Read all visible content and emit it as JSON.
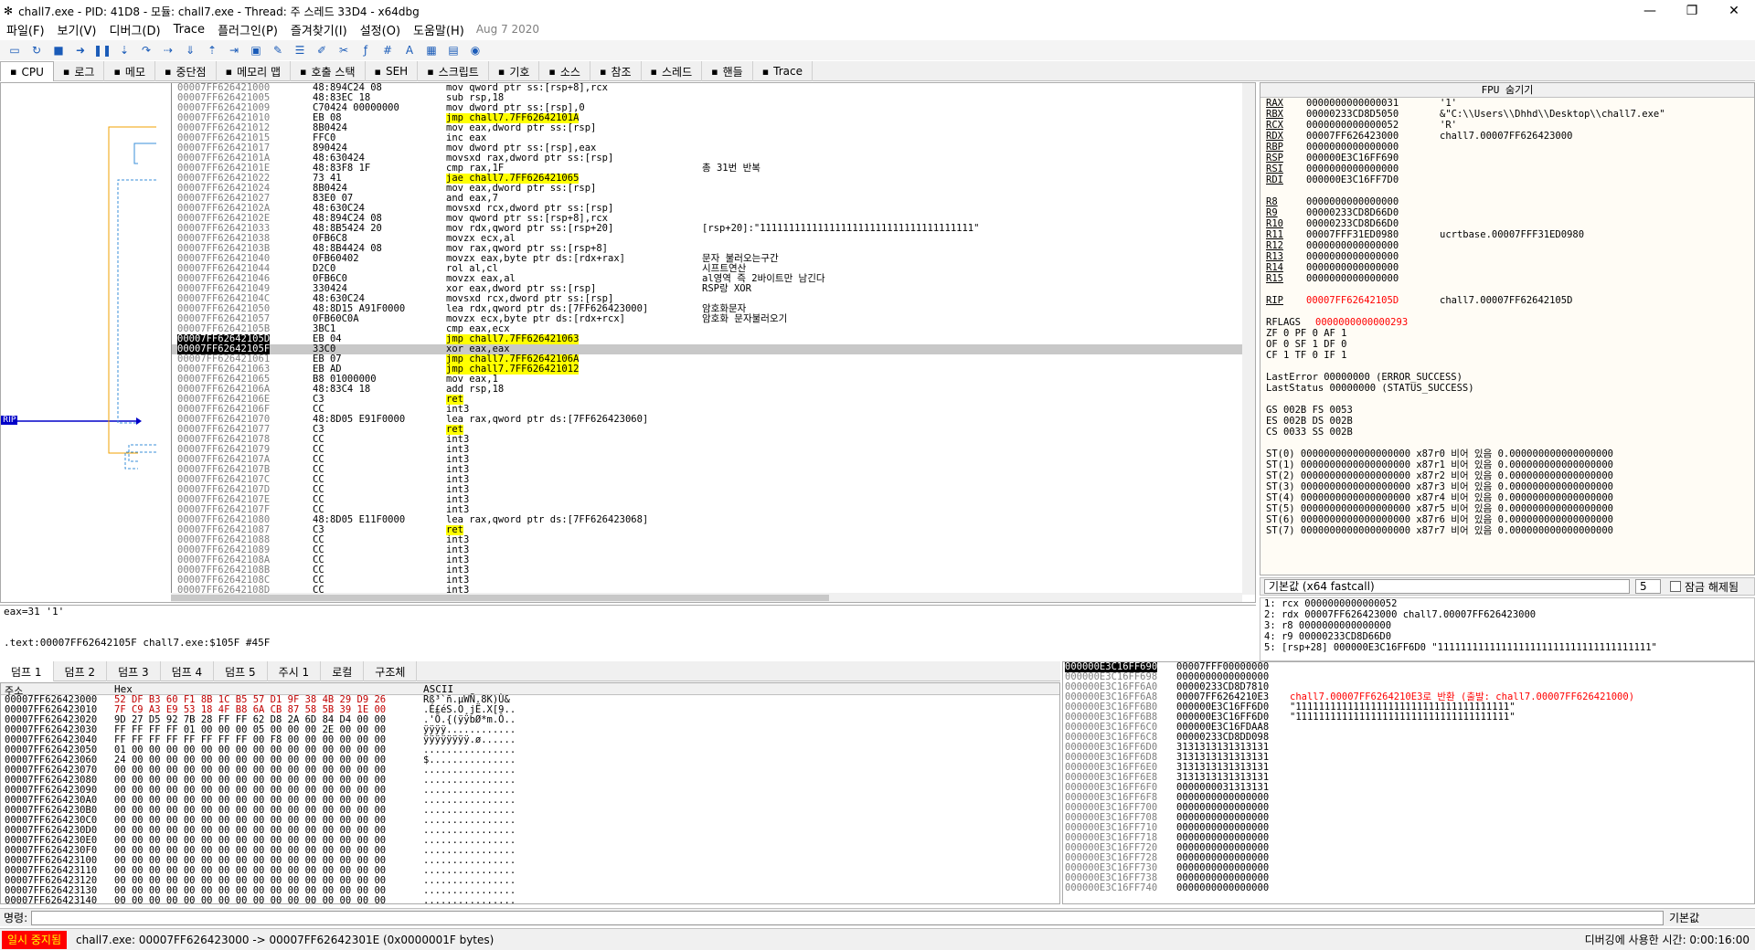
{
  "window": {
    "title": "chall7.exe - PID: 41D8 - 모듈: chall7.exe - Thread: 주 스레드 33D4 - x64dbg",
    "buttons": [
      "—",
      "❐",
      "✕"
    ]
  },
  "menu": {
    "items": [
      "파일(F)",
      "보기(V)",
      "디버그(D)",
      "Trace",
      "플러그인(P)",
      "즐겨찾기(I)",
      "설정(O)",
      "도움말(H)"
    ],
    "date": "Aug 7 2020"
  },
  "tabs": [
    {
      "label": "CPU",
      "icon": "cpu-icon",
      "active": true
    },
    {
      "label": "로그",
      "icon": "log-icon"
    },
    {
      "label": "메모",
      "icon": "notes-icon"
    },
    {
      "label": "중단점",
      "icon": "breakpoint-icon"
    },
    {
      "label": "메모리 맵",
      "icon": "memory-map-icon"
    },
    {
      "label": "호출 스택",
      "icon": "call-stack-icon"
    },
    {
      "label": "SEH",
      "icon": "seh-icon"
    },
    {
      "label": "스크립트",
      "icon": "script-icon"
    },
    {
      "label": "기호",
      "icon": "symbols-icon"
    },
    {
      "label": "소스",
      "icon": "source-icon"
    },
    {
      "label": "참조",
      "icon": "references-icon"
    },
    {
      "label": "스레드",
      "icon": "threads-icon"
    },
    {
      "label": "핸들",
      "icon": "handles-icon"
    },
    {
      "label": "Trace",
      "icon": "trace-icon"
    }
  ],
  "disasm": {
    "rip_label": "RIP",
    "rows": [
      {
        "addr": "00007FF626421000",
        "bytes": "48:894C24 08",
        "dis": "mov qword ptr ss:[rsp+8],rcx",
        "cmt": ""
      },
      {
        "addr": "00007FF626421005",
        "bytes": "48:83EC 18",
        "dis": "sub rsp,18",
        "cmt": ""
      },
      {
        "addr": "00007FF626421009",
        "bytes": "C70424 00000000",
        "dis": "mov dword ptr ss:[rsp],0",
        "cmt": ""
      },
      {
        "addr": "00007FF626421010",
        "bytes": "EB 08",
        "dis": "jmp chall7.7FF62642101A",
        "cmt": "",
        "hl": true
      },
      {
        "addr": "00007FF626421012",
        "bytes": "8B0424",
        "dis": "mov eax,dword ptr ss:[rsp]",
        "cmt": ""
      },
      {
        "addr": "00007FF626421015",
        "bytes": "FFC0",
        "dis": "inc eax",
        "cmt": ""
      },
      {
        "addr": "00007FF626421017",
        "bytes": "890424",
        "dis": "mov dword ptr ss:[rsp],eax",
        "cmt": ""
      },
      {
        "addr": "00007FF62642101A",
        "bytes": "48:630424",
        "dis": "movsxd rax,dword ptr ss:[rsp]",
        "cmt": ""
      },
      {
        "addr": "00007FF62642101E",
        "bytes": "48:83F8 1F",
        "dis": "cmp rax,1F",
        "cmt": "총 31번 반복"
      },
      {
        "addr": "00007FF626421022",
        "bytes": "73 41",
        "dis": "jae chall7.7FF626421065",
        "cmt": "",
        "hl": true
      },
      {
        "addr": "00007FF626421024",
        "bytes": "8B0424",
        "dis": "mov eax,dword ptr ss:[rsp]",
        "cmt": ""
      },
      {
        "addr": "00007FF626421027",
        "bytes": "83E0 07",
        "dis": "and eax,7",
        "cmt": ""
      },
      {
        "addr": "00007FF62642102A",
        "bytes": "48:630C24",
        "dis": "movsxd rcx,dword ptr ss:[rsp]",
        "cmt": ""
      },
      {
        "addr": "00007FF62642102E",
        "bytes": "48:894C24 08",
        "dis": "mov qword ptr ss:[rsp+8],rcx",
        "cmt": ""
      },
      {
        "addr": "00007FF626421033",
        "bytes": "48:8B5424 20",
        "dis": "mov rdx,qword ptr ss:[rsp+20]",
        "cmt": "[rsp+20]:\"1111111111111111111111111111111111111\""
      },
      {
        "addr": "00007FF626421038",
        "bytes": "0FB6C8",
        "dis": "movzx ecx,al",
        "cmt": ""
      },
      {
        "addr": "00007FF62642103B",
        "bytes": "48:8B4424 08",
        "dis": "mov rax,qword ptr ss:[rsp+8]",
        "cmt": ""
      },
      {
        "addr": "00007FF626421040",
        "bytes": "0FB60402",
        "dis": "movzx eax,byte ptr ds:[rdx+rax]",
        "cmt": "문자 불러오는구간"
      },
      {
        "addr": "00007FF626421044",
        "bytes": "D2C0",
        "dis": "rol al,cl",
        "cmt": "시프트연산"
      },
      {
        "addr": "00007FF626421046",
        "bytes": "0FB6C0",
        "dis": "movzx eax,al",
        "cmt": "al영역 즉 2바이트만 남긴다"
      },
      {
        "addr": "00007FF626421049",
        "bytes": "330424",
        "dis": "xor eax,dword ptr ss:[rsp]",
        "cmt": "RSP랑 XOR"
      },
      {
        "addr": "00007FF62642104C",
        "bytes": "48:630C24",
        "dis": "movsxd rcx,dword ptr ss:[rsp]",
        "cmt": ""
      },
      {
        "addr": "00007FF626421050",
        "bytes": "48:8D15 A91F0000",
        "dis": "lea rdx,qword ptr ds:[7FF626423000]",
        "cmt": "암호화문자"
      },
      {
        "addr": "00007FF626421057",
        "bytes": "0FB60C0A",
        "dis": "movzx ecx,byte ptr ds:[rdx+rcx]",
        "cmt": "암호화 문자불러오기"
      },
      {
        "addr": "00007FF62642105B",
        "bytes": "3BC1",
        "dis": "cmp eax,ecx",
        "cmt": ""
      },
      {
        "addr": "00007FF62642105D",
        "bytes": "EB 04",
        "dis": "jmp chall7.7FF626421063",
        "cmt": "",
        "hl": true,
        "cur": true
      },
      {
        "addr": "00007FF62642105F",
        "bytes": "33C0",
        "dis": "xor eax,eax",
        "cmt": "",
        "sel": true
      },
      {
        "addr": "00007FF626421061",
        "bytes": "EB 07",
        "dis": "jmp chall7.7FF62642106A",
        "cmt": "",
        "hl": true
      },
      {
        "addr": "00007FF626421063",
        "bytes": "EB AD",
        "dis": "jmp chall7.7FF626421012",
        "cmt": "",
        "hl": true
      },
      {
        "addr": "00007FF626421065",
        "bytes": "B8 01000000",
        "dis": "mov eax,1",
        "cmt": ""
      },
      {
        "addr": "00007FF62642106A",
        "bytes": "48:83C4 18",
        "dis": "add rsp,18",
        "cmt": ""
      },
      {
        "addr": "00007FF62642106E",
        "bytes": "C3",
        "dis": "ret",
        "cmt": "",
        "hl": true
      },
      {
        "addr": "00007FF62642106F",
        "bytes": "CC",
        "dis": "int3",
        "cmt": ""
      },
      {
        "addr": "00007FF626421070",
        "bytes": "48:8D05 E91F0000",
        "dis": "lea rax,qword ptr ds:[7FF626423060]",
        "cmt": ""
      },
      {
        "addr": "00007FF626421077",
        "bytes": "C3",
        "dis": "ret",
        "cmt": "",
        "hl": true
      },
      {
        "addr": "00007FF626421078",
        "bytes": "CC",
        "dis": "int3",
        "cmt": ""
      },
      {
        "addr": "00007FF626421079",
        "bytes": "CC",
        "dis": "int3",
        "cmt": ""
      },
      {
        "addr": "00007FF62642107A",
        "bytes": "CC",
        "dis": "int3",
        "cmt": ""
      },
      {
        "addr": "00007FF62642107B",
        "bytes": "CC",
        "dis": "int3",
        "cmt": ""
      },
      {
        "addr": "00007FF62642107C",
        "bytes": "CC",
        "dis": "int3",
        "cmt": ""
      },
      {
        "addr": "00007FF62642107D",
        "bytes": "CC",
        "dis": "int3",
        "cmt": ""
      },
      {
        "addr": "00007FF62642107E",
        "bytes": "CC",
        "dis": "int3",
        "cmt": ""
      },
      {
        "addr": "00007FF62642107F",
        "bytes": "CC",
        "dis": "int3",
        "cmt": ""
      },
      {
        "addr": "00007FF626421080",
        "bytes": "48:8D05 E11F0000",
        "dis": "lea rax,qword ptr ds:[7FF626423068]",
        "cmt": ""
      },
      {
        "addr": "00007FF626421087",
        "bytes": "C3",
        "dis": "ret",
        "cmt": "",
        "hl": true
      },
      {
        "addr": "00007FF626421088",
        "bytes": "CC",
        "dis": "int3",
        "cmt": ""
      },
      {
        "addr": "00007FF626421089",
        "bytes": "CC",
        "dis": "int3",
        "cmt": ""
      },
      {
        "addr": "00007FF62642108A",
        "bytes": "CC",
        "dis": "int3",
        "cmt": ""
      },
      {
        "addr": "00007FF62642108B",
        "bytes": "CC",
        "dis": "int3",
        "cmt": ""
      },
      {
        "addr": "00007FF62642108C",
        "bytes": "CC",
        "dis": "int3",
        "cmt": ""
      },
      {
        "addr": "00007FF62642108D",
        "bytes": "CC",
        "dis": "int3",
        "cmt": ""
      }
    ]
  },
  "info": {
    "line1": "eax=31 '1'",
    "line2": ".text:00007FF62642105F chall7.exe:$105F #45F"
  },
  "registers": {
    "header": "FPU 숨기기",
    "gpr": [
      {
        "n": "RAX",
        "v": "0000000000000031",
        "c": "'1'"
      },
      {
        "n": "RBX",
        "v": "00000233CD8D5050",
        "c": "&\"C:\\\\Users\\\\Dhhd\\\\Desktop\\\\chall7.exe\""
      },
      {
        "n": "RCX",
        "v": "0000000000000052",
        "c": "'R'"
      },
      {
        "n": "RDX",
        "v": "00007FF626423000",
        "c": "chall7.00007FF626423000"
      },
      {
        "n": "RBP",
        "v": "0000000000000000",
        "c": ""
      },
      {
        "n": "RSP",
        "v": "000000E3C16FF690",
        "c": ""
      },
      {
        "n": "RSI",
        "v": "0000000000000000",
        "c": ""
      },
      {
        "n": "RDI",
        "v": "000000E3C16FF7D0",
        "c": ""
      },
      {
        "n": "",
        "v": "",
        "c": ""
      },
      {
        "n": "R8",
        "v": "0000000000000000",
        "c": ""
      },
      {
        "n": "R9",
        "v": "00000233CD8D66D0",
        "c": ""
      },
      {
        "n": "R10",
        "v": "00000233CD8D66D0",
        "c": ""
      },
      {
        "n": "R11",
        "v": "00007FFF31ED0980",
        "c": "ucrtbase.00007FFF31ED0980"
      },
      {
        "n": "R12",
        "v": "0000000000000000",
        "c": ""
      },
      {
        "n": "R13",
        "v": "0000000000000000",
        "c": ""
      },
      {
        "n": "R14",
        "v": "0000000000000000",
        "c": ""
      },
      {
        "n": "R15",
        "v": "0000000000000000",
        "c": ""
      },
      {
        "n": "",
        "v": "",
        "c": ""
      },
      {
        "n": "RIP",
        "v": "00007FF62642105D",
        "c": "chall7.00007FF62642105D"
      }
    ],
    "rflags": {
      "n": "RFLAGS",
      "v": "0000000000000293"
    },
    "flags": [
      "ZF 0  PF 0  AF 1",
      "OF 0  SF 1  DF 0",
      "CF 1  TF 0  IF 1"
    ],
    "last": [
      "LastError  00000000 (ERROR_SUCCESS)",
      "LastStatus 00000000 (STATUS_SUCCESS)"
    ],
    "seg": [
      "GS 002B  FS 0053",
      "ES 002B  DS 002B",
      "CS 0033  SS 002B"
    ],
    "fpu": [
      "ST(0) 0000000000000000000 x87r0 비어 있음 0.000000000000000000",
      "ST(1) 0000000000000000000 x87r1 비어 있음 0.000000000000000000",
      "ST(2) 0000000000000000000 x87r2 비어 있음 0.000000000000000000",
      "ST(3) 0000000000000000000 x87r3 비어 있음 0.000000000000000000",
      "ST(4) 0000000000000000000 x87r4 비어 있음 0.000000000000000000",
      "ST(5) 0000000000000000000 x87r5 비어 있음 0.000000000000000000",
      "ST(6) 0000000000000000000 x87r6 비어 있음 0.000000000000000000",
      "ST(7) 0000000000000000000 x87r7 비어 있음 0.000000000000000000"
    ]
  },
  "callconv": {
    "label": "기본값 (x64 fastcall)",
    "count": "5",
    "lock": "잠금 해제됨"
  },
  "args": [
    "1: rcx 0000000000000052",
    "2: rdx 00007FF626423000 chall7.00007FF626423000",
    "3: r8 0000000000000000",
    "4: r9 00000233CD8D66D0",
    "5: [rsp+28] 000000E3C16FF6D0 \"1111111111111111111111111111111111111\""
  ],
  "dump_tabs": [
    "덤프 1",
    "덤프 2",
    "덤프 3",
    "덤프 4",
    "덤프 5",
    "주시 1",
    "로컬",
    "구조체"
  ],
  "dump": {
    "headers": {
      "addr": "주소",
      "hex": "Hex",
      "ascii": "ASCII"
    },
    "rows": [
      {
        "a": "00007FF626423000",
        "h": "52 DF B3 60 F1 8B 1C B5 57 D1 9F 38 4B 29 D9 26",
        "s": "Rß³`ñ.µWÑ.8K)Ù&"
      },
      {
        "a": "00007FF626423010",
        "h": "7F C9 A3 E9 53 18 4F B8 6A CB 87 58 5B 39 1E 00",
        "s": ".É£éS.O¸jË.X[9.."
      },
      {
        "a": "00007FF626423020",
        "h": "9D 27 D5 92 7B 28 FF FF 62 D8 2A 6D 84 D4 00 00",
        "s": ".'Õ.{(ÿÿbØ*m.Ô.."
      },
      {
        "a": "00007FF626423030",
        "h": "FF FF FF FF 01 00 00 00 05 00 00 00 2E 00 00 00",
        "s": "ÿÿÿÿ............"
      },
      {
        "a": "00007FF626423040",
        "h": "FF FF FF FF FF FF FF FF 00 F8 00 00 00 00 00 00",
        "s": "ÿÿÿÿÿÿÿÿ.ø......"
      },
      {
        "a": "00007FF626423050",
        "h": "01 00 00 00 00 00 00 00 00 00 00 00 00 00 00 00",
        "s": "................"
      },
      {
        "a": "00007FF626423060",
        "h": "24 00 00 00 00 00 00 00 00 00 00 00 00 00 00 00",
        "s": "$..............."
      },
      {
        "a": "00007FF626423070",
        "h": "00 00 00 00 00 00 00 00 00 00 00 00 00 00 00 00",
        "s": "................"
      },
      {
        "a": "00007FF626423080",
        "h": "00 00 00 00 00 00 00 00 00 00 00 00 00 00 00 00",
        "s": "................"
      },
      {
        "a": "00007FF626423090",
        "h": "00 00 00 00 00 00 00 00 00 00 00 00 00 00 00 00",
        "s": "................"
      },
      {
        "a": "00007FF6264230A0",
        "h": "00 00 00 00 00 00 00 00 00 00 00 00 00 00 00 00",
        "s": "................"
      },
      {
        "a": "00007FF6264230B0",
        "h": "00 00 00 00 00 00 00 00 00 00 00 00 00 00 00 00",
        "s": "................"
      },
      {
        "a": "00007FF6264230C0",
        "h": "00 00 00 00 00 00 00 00 00 00 00 00 00 00 00 00",
        "s": "................"
      },
      {
        "a": "00007FF6264230D0",
        "h": "00 00 00 00 00 00 00 00 00 00 00 00 00 00 00 00",
        "s": "................"
      },
      {
        "a": "00007FF6264230E0",
        "h": "00 00 00 00 00 00 00 00 00 00 00 00 00 00 00 00",
        "s": "................"
      },
      {
        "a": "00007FF6264230F0",
        "h": "00 00 00 00 00 00 00 00 00 00 00 00 00 00 00 00",
        "s": "................"
      },
      {
        "a": "00007FF626423100",
        "h": "00 00 00 00 00 00 00 00 00 00 00 00 00 00 00 00",
        "s": "................"
      },
      {
        "a": "00007FF626423110",
        "h": "00 00 00 00 00 00 00 00 00 00 00 00 00 00 00 00",
        "s": "................"
      },
      {
        "a": "00007FF626423120",
        "h": "00 00 00 00 00 00 00 00 00 00 00 00 00 00 00 00",
        "s": "................"
      },
      {
        "a": "00007FF626423130",
        "h": "00 00 00 00 00 00 00 00 00 00 00 00 00 00 00 00",
        "s": "................"
      },
      {
        "a": "00007FF626423140",
        "h": "00 00 00 00 00 00 00 00 00 00 00 00 00 00 00 00",
        "s": "................"
      }
    ]
  },
  "stack": {
    "rows": [
      {
        "a": "000000E3C16FF690",
        "v": "00007FFF00000000",
        "c": "",
        "top": true
      },
      {
        "a": "000000E3C16FF698",
        "v": "0000000000000000",
        "c": ""
      },
      {
        "a": "000000E3C16FF6A0",
        "v": "00000233CD8D7810",
        "c": ""
      },
      {
        "a": "000000E3C16FF6A8",
        "v": "00007FF6264210E3",
        "c": "chall7.00007FF6264210E3로 반환 (출발: chall7.00007FF626421000)",
        "red": true
      },
      {
        "a": "000000E3C16FF6B0",
        "v": "000000E3C16FF6D0",
        "c": "\"1111111111111111111111111111111111111\""
      },
      {
        "a": "000000E3C16FF6B8",
        "v": "000000E3C16FF6D0",
        "c": "\"1111111111111111111111111111111111111\""
      },
      {
        "a": "000000E3C16FF6C0",
        "v": "000000E3C16FDAA8",
        "c": ""
      },
      {
        "a": "000000E3C16FF6C8",
        "v": "00000233CD8DD098",
        "c": ""
      },
      {
        "a": "000000E3C16FF6D0",
        "v": "3131313131313131",
        "c": ""
      },
      {
        "a": "000000E3C16FF6D8",
        "v": "3131313131313131",
        "c": ""
      },
      {
        "a": "000000E3C16FF6E0",
        "v": "3131313131313131",
        "c": ""
      },
      {
        "a": "000000E3C16FF6E8",
        "v": "3131313131313131",
        "c": ""
      },
      {
        "a": "000000E3C16FF6F0",
        "v": "0000000031313131",
        "c": ""
      },
      {
        "a": "000000E3C16FF6F8",
        "v": "0000000000000000",
        "c": ""
      },
      {
        "a": "000000E3C16FF700",
        "v": "0000000000000000",
        "c": ""
      },
      {
        "a": "000000E3C16FF708",
        "v": "0000000000000000",
        "c": ""
      },
      {
        "a": "000000E3C16FF710",
        "v": "0000000000000000",
        "c": ""
      },
      {
        "a": "000000E3C16FF718",
        "v": "0000000000000000",
        "c": ""
      },
      {
        "a": "000000E3C16FF720",
        "v": "0000000000000000",
        "c": ""
      },
      {
        "a": "000000E3C16FF728",
        "v": "0000000000000000",
        "c": ""
      },
      {
        "a": "000000E3C16FF730",
        "v": "0000000000000000",
        "c": ""
      },
      {
        "a": "000000E3C16FF738",
        "v": "0000000000000000",
        "c": ""
      },
      {
        "a": "000000E3C16FF740",
        "v": "0000000000000000",
        "c": ""
      }
    ]
  },
  "command": {
    "label": "명령:",
    "default": "기본값"
  },
  "status": {
    "state": "일시 중지됨",
    "message": "chall7.exe: 00007FF626423000 -> 00007FF62642301E (0x0000001F bytes)",
    "time": "디버깅에 사용한 시간: 0:00:16:00"
  }
}
